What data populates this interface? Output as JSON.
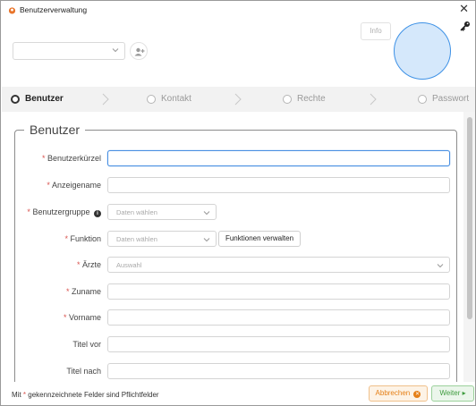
{
  "window": {
    "title": "Benutzerverwaltung",
    "close_glyph": "✕",
    "icon_color": "#e8742a"
  },
  "header": {
    "user_select_value": "",
    "info_label": "Info",
    "avatar_color": "#d5e8fb"
  },
  "steps": [
    {
      "label": "Benutzer",
      "active": true
    },
    {
      "label": "Kontakt",
      "active": false
    },
    {
      "label": "Rechte",
      "active": false
    },
    {
      "label": "Passwort",
      "active": false
    }
  ],
  "section": {
    "title": "Benutzer"
  },
  "form": {
    "required_mark": "*",
    "kuerzel": {
      "label": "Benutzerkürzel",
      "value": ""
    },
    "anzeigename": {
      "label": "Anzeigename",
      "value": ""
    },
    "benutzergruppe": {
      "label": "Benutzergruppe",
      "placeholder": "Daten wählen",
      "info_glyph": "i"
    },
    "funktion": {
      "label": "Funktion",
      "placeholder": "Daten wählen",
      "manage_label": "Funktionen verwalten"
    },
    "aerzte": {
      "label": "Ärzte",
      "placeholder": "Auswahl"
    },
    "zuname": {
      "label": "Zuname",
      "value": ""
    },
    "vorname": {
      "label": "Vorname",
      "value": ""
    },
    "titel_vor": {
      "label": "Titel vor",
      "value": ""
    },
    "titel_nach": {
      "label": "Titel nach",
      "value": ""
    }
  },
  "footer": {
    "note_prefix": "Mit",
    "note_mark": "*",
    "note_suffix": "gekennzeichnete Felder sind Pflichtfelder",
    "cancel_label": "Abbrechen",
    "cancel_glyph": "✕",
    "next_label": "Weiter",
    "next_glyph": "▸"
  },
  "colors": {
    "accent": "#4a90e2",
    "required": "#d9534f",
    "cancel": "#e57f17",
    "next": "#3d9b3d"
  }
}
